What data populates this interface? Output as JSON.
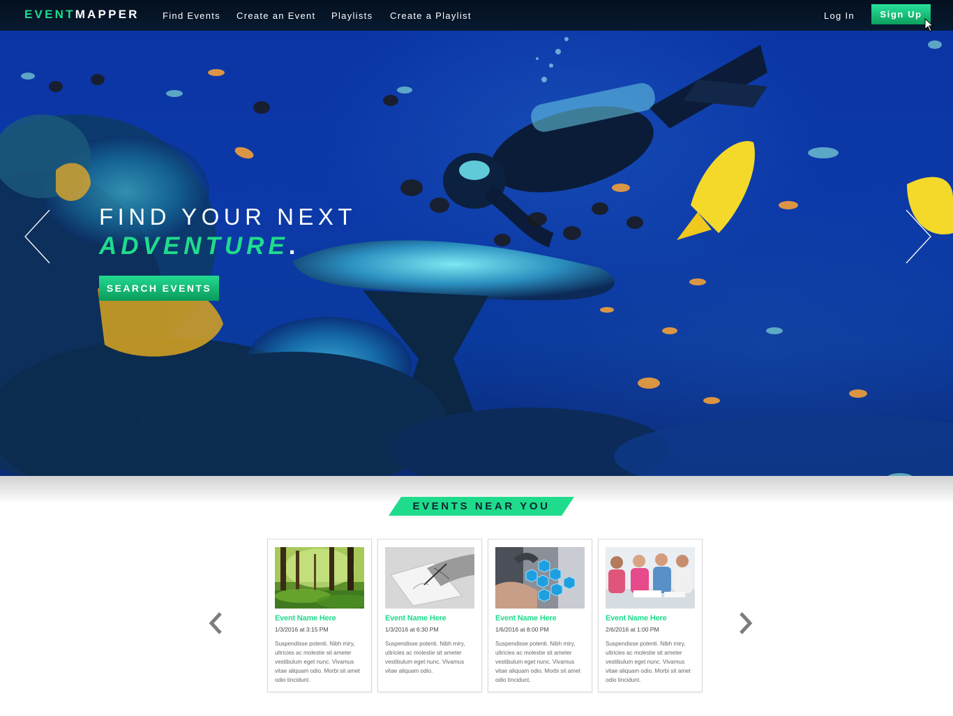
{
  "brand": {
    "part1": "EVENT",
    "part2": "MAPPER"
  },
  "nav": {
    "links": [
      "Find Events",
      "Create an Event",
      "Playlists",
      "Create a Playlist"
    ],
    "login": "Log In",
    "signup": "Sign Up"
  },
  "hero": {
    "line1": "FIND YOUR NEXT",
    "line2": "ADVENTURE",
    "line2_end": ".",
    "cta": "SEARCH EVENTS"
  },
  "events": {
    "section_title": "EVENTS NEAR YOU",
    "cards": [
      {
        "title": "Event Name Here",
        "date": "1/3/2016 at 3:15 PM",
        "description": "Suspendisse potenti. Nibh miry, ultricies ac molestie sit ameter vestibulum eget nunc. Vivamus vitae aliquam odio. Morbi sit amet odio tincidunt.",
        "image": "forest-photo"
      },
      {
        "title": "Event Name Here",
        "date": "1/3/2016 at 6:30 PM",
        "description": "Suspendisse potenti. Nibh miry, ultricies ac molestie sit ameter vestibulum eget nunc. Vivamus vitae aliquam odio.",
        "image": "drawing-hand-photo"
      },
      {
        "title": "Event Name Here",
        "date": "1/6/2016 at 8:00 PM",
        "description": "Suspendisse potenti. Nibh miry, ultricies ac molestie sit ameter vestibulum eget nunc. Vivamus vitae aliquam odio. Morbi sit amet odio tincidunt.",
        "image": "tech-hexagons-photo"
      },
      {
        "title": "Event Name Here",
        "date": "2/6/2016 at 1:00 PM",
        "description": "Suspendisse potenti. Nibh miry, ultricies ac molestie sit ameter vestibulum eget nunc. Vivamus vitae aliquam odio. Morbi sit amet odio tincidunt.",
        "image": "team-meeting-photo"
      }
    ]
  },
  "colors": {
    "accent": "#1fdc8c",
    "nav_bg": "#061628",
    "hero_blue": "#0c3dbd"
  },
  "icons": {
    "hero_prev": "chevron-left-icon",
    "hero_next": "chevron-right-icon",
    "cards_prev": "chevron-left-icon",
    "cards_next": "chevron-right-icon",
    "cursor": "mouse-pointer-icon"
  }
}
